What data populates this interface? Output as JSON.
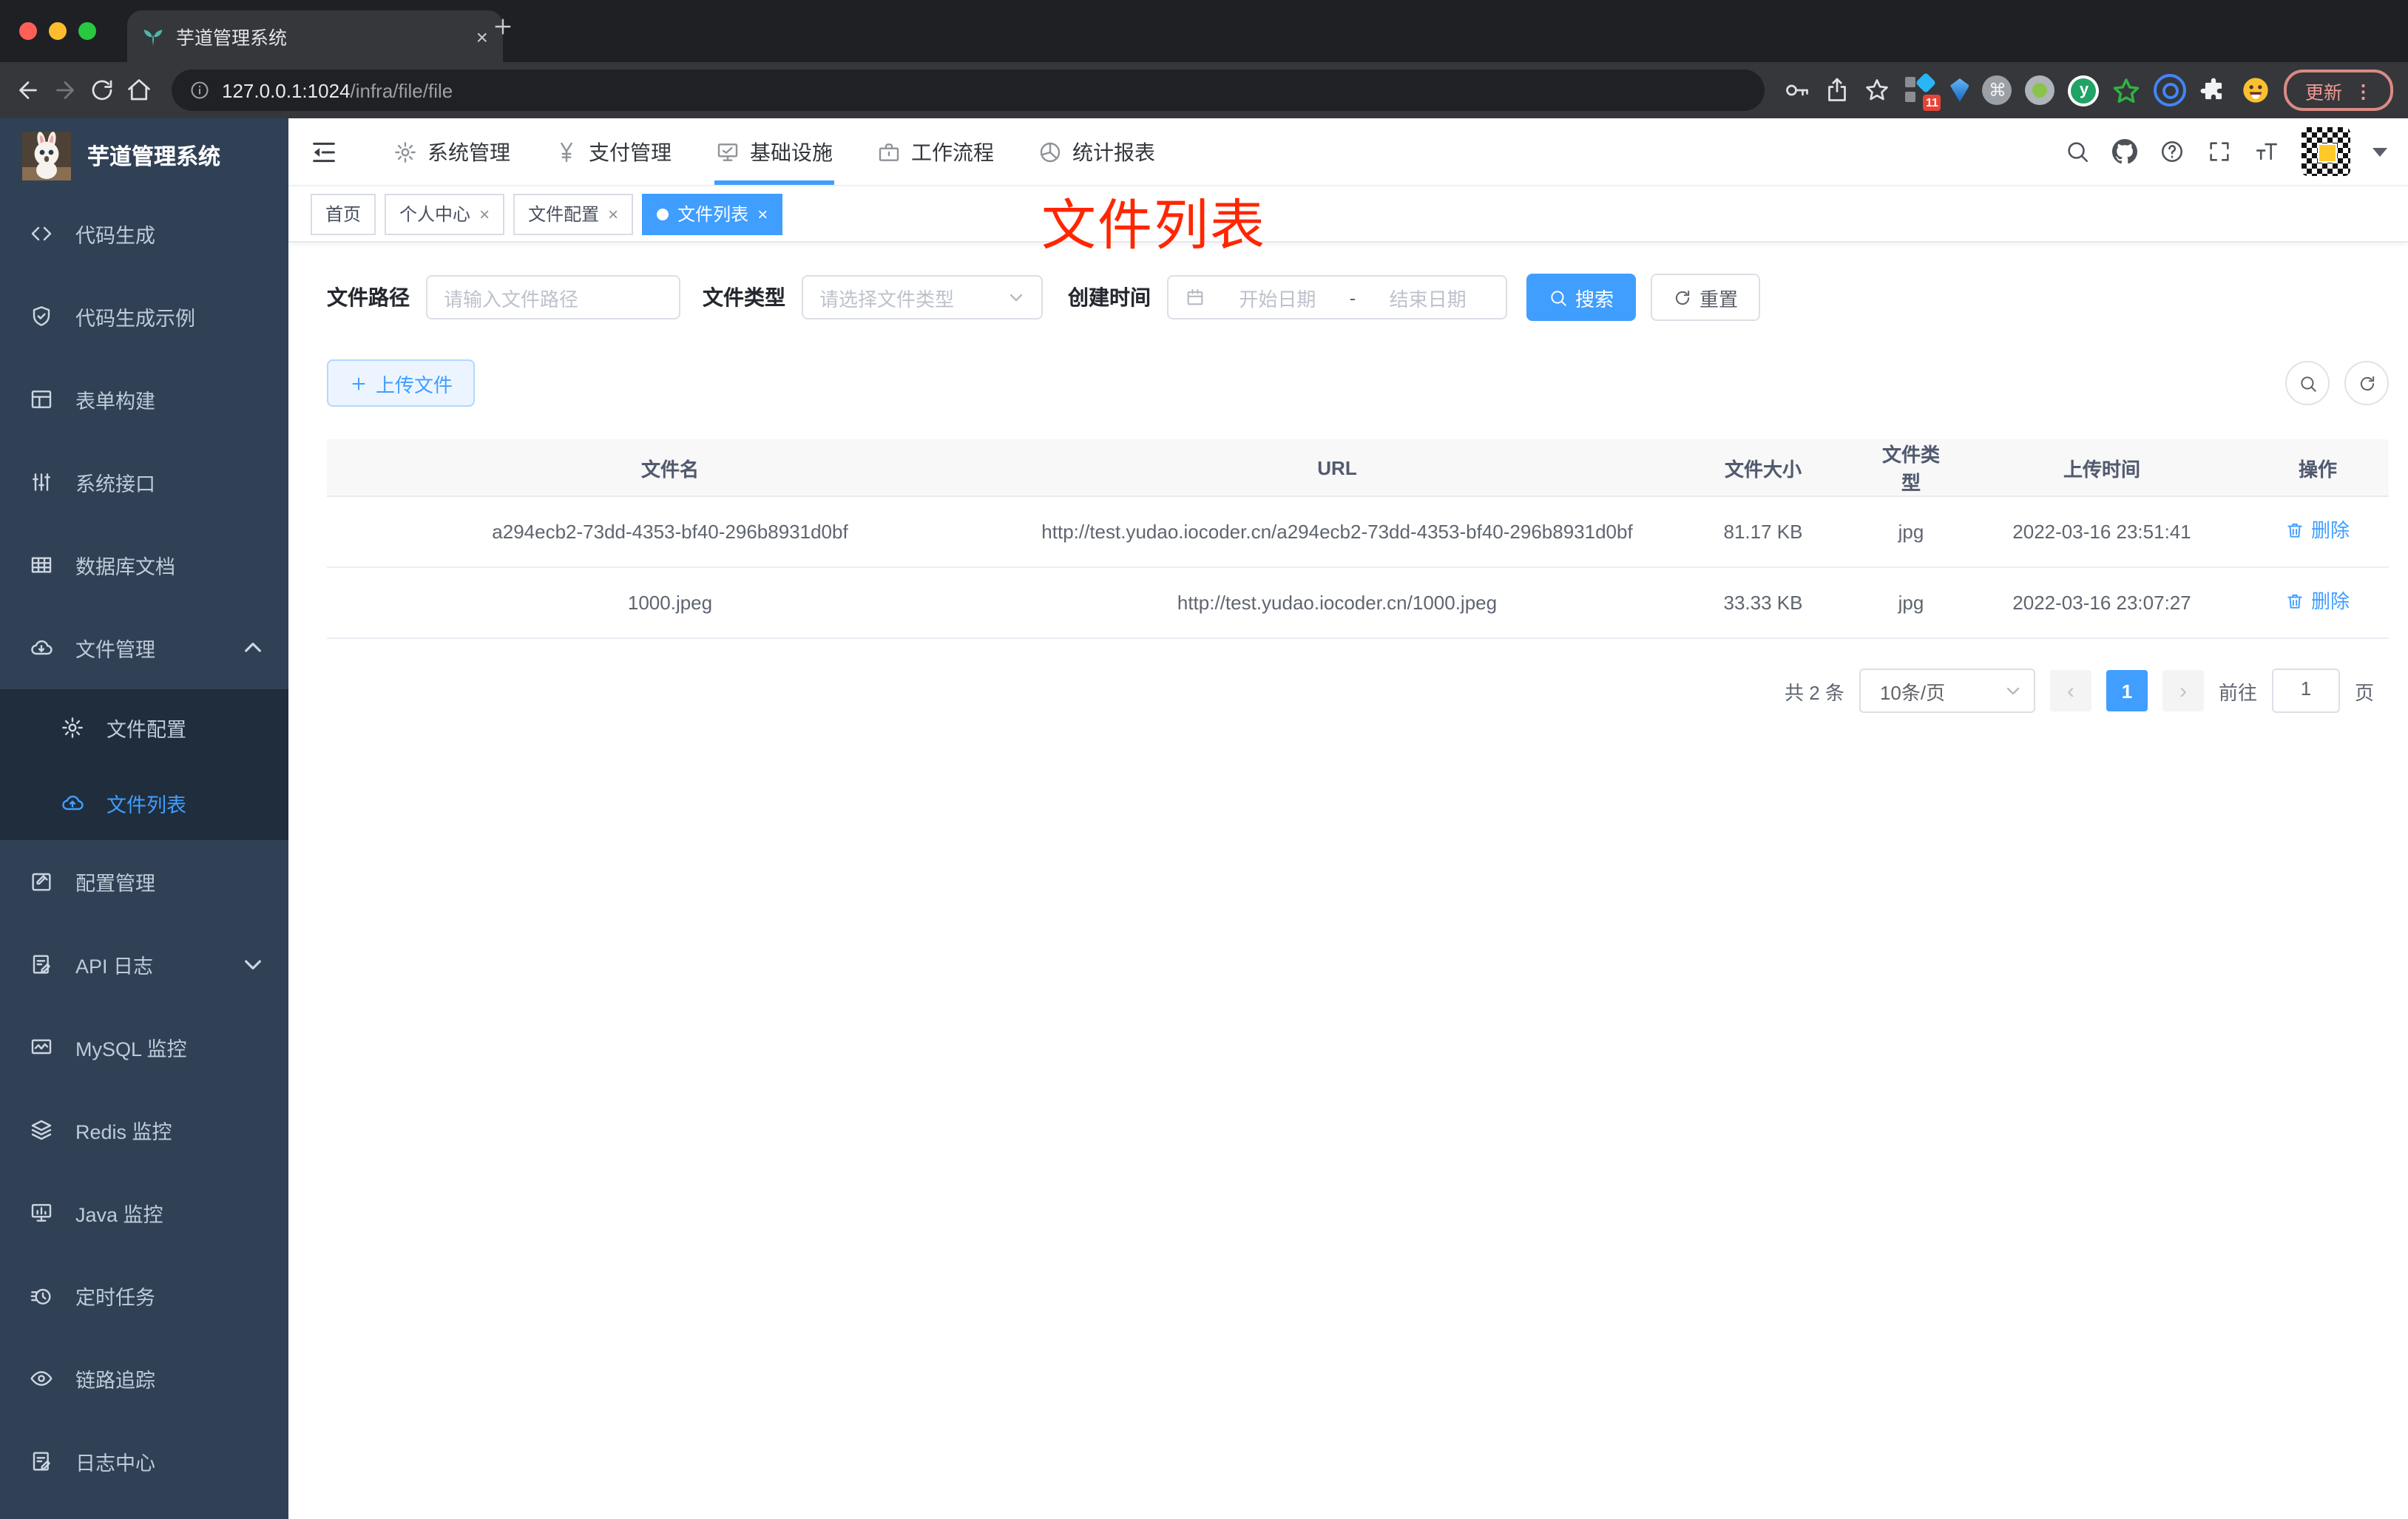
{
  "colors": {
    "accent": "#409eff",
    "annotation_red": "#ff2600",
    "sidebar_bg": "#304156",
    "submenu_bg": "#1f2d3d",
    "tag_active_bg": "#409eff"
  },
  "browser": {
    "tab_title": "芋道管理系统",
    "url_host": "127.0.0.1:1024",
    "url_path": "/infra/file/file",
    "update_button": "更新",
    "extension_badge": "11",
    "cmd_glyph": "⌘",
    "y_ext_letter": "y"
  },
  "icons": {
    "close": "×",
    "plus": "＋",
    "prev": "‹",
    "next": "›",
    "dots": "⋮"
  },
  "sidebar": {
    "title": "芋道管理系统",
    "items": [
      {
        "label": "代码生成"
      },
      {
        "label": "代码生成示例"
      },
      {
        "label": "表单构建"
      },
      {
        "label": "系统接口"
      },
      {
        "label": "数据库文档"
      },
      {
        "label": "文件管理"
      },
      {
        "label": "文件配置"
      },
      {
        "label": "文件列表"
      },
      {
        "label": "配置管理"
      },
      {
        "label": "API 日志"
      },
      {
        "label": "MySQL 监控"
      },
      {
        "label": "Redis 监控"
      },
      {
        "label": "Java 监控"
      },
      {
        "label": "定时任务"
      },
      {
        "label": "链路追踪"
      },
      {
        "label": "日志中心"
      }
    ]
  },
  "header": {
    "menus": [
      {
        "label": "系统管理"
      },
      {
        "label": "支付管理"
      },
      {
        "label": "基础设施"
      },
      {
        "label": "工作流程"
      },
      {
        "label": "统计报表"
      }
    ]
  },
  "tags": [
    {
      "label": "首页"
    },
    {
      "label": "个人中心"
    },
    {
      "label": "文件配置"
    },
    {
      "label": "文件列表"
    }
  ],
  "annotation": {
    "text": "文件列表"
  },
  "filters": {
    "path_label": "文件路径",
    "path_placeholder": "请输入文件路径",
    "type_label": "文件类型",
    "type_placeholder": "请选择文件类型",
    "date_label": "创建时间",
    "date_start_placeholder": "开始日期",
    "range_separator": "-",
    "date_end_placeholder": "结束日期",
    "search_button": "搜索",
    "reset_button": "重置"
  },
  "toolbar": {
    "upload_button": "上传文件"
  },
  "table": {
    "columns": [
      "文件名",
      "URL",
      "文件大小",
      "文件类型",
      "上传时间",
      "操作"
    ],
    "rows": [
      {
        "name": "a294ecb2-73dd-4353-bf40-296b8931d0bf",
        "url": "http://test.yudao.iocoder.cn/a294ecb2-73dd-4353-bf40-296b8931d0bf",
        "size": "81.17 KB",
        "type": "jpg",
        "time": "2022-03-16 23:51:41",
        "action": "删除"
      },
      {
        "name": "1000.jpeg",
        "url": "http://test.yudao.iocoder.cn/1000.jpeg",
        "size": "33.33 KB",
        "type": "jpg",
        "time": "2022-03-16 23:07:27",
        "action": "删除"
      }
    ]
  },
  "pagination": {
    "total": "共 2 条",
    "page_size": "10条/页",
    "current_page": "1",
    "goto_label": "前往",
    "goto_value": "1",
    "page_suffix": "页"
  }
}
